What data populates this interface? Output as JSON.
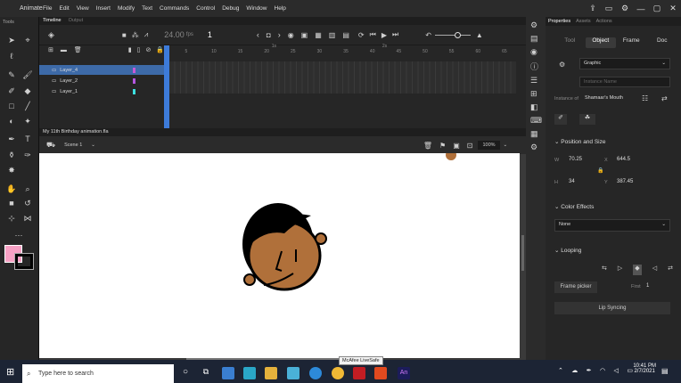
{
  "app": {
    "name": "Animate"
  },
  "menu": [
    "File",
    "Edit",
    "View",
    "Insert",
    "Modify",
    "Text",
    "Commands",
    "Control",
    "Debug",
    "Window",
    "Help"
  ],
  "tools_label": "Tools",
  "timeline": {
    "tabs": [
      "Timeline",
      "Output"
    ],
    "fps": "24.00",
    "fps_unit": "fps",
    "frame": "1",
    "layers": [
      {
        "name": "Layer_4",
        "color": "#c85ad6"
      },
      {
        "name": "Layer_2",
        "color": "#b557e0"
      },
      {
        "name": "Layer_1",
        "color": "#3de0e0"
      }
    ],
    "ruler": [
      "1s",
      "2s",
      "5",
      "10",
      "15",
      "20",
      "25",
      "30",
      "35",
      "40",
      "45",
      "50",
      "55",
      "60",
      "65"
    ]
  },
  "doc": {
    "tab": "My 11th Birthday animation.fla",
    "scene": "Scene 1",
    "zoom": "100%"
  },
  "props": {
    "tabs": [
      "Properties",
      "Assets",
      "Actions"
    ],
    "subtabs": [
      "Tool",
      "Object",
      "Frame",
      "Doc"
    ],
    "symbol_type": "Graphic",
    "instance_placeholder": "Instance Name",
    "instance_of_label": "Instance of",
    "instance_of": "Shamaar's Mouth",
    "pos_header": "Position and Size",
    "w_label": "W",
    "w": "70.25",
    "x_label": "X",
    "x": "644.5",
    "h_label": "H",
    "h": "34",
    "y_label": "Y",
    "y": "387.45",
    "color_header": "Color Effects",
    "color_effect": "None",
    "looping_header": "Looping",
    "frame_picker": "Frame picker",
    "first_label": "First",
    "first": "1",
    "lip": "Lip Syncing"
  },
  "taskbar": {
    "search_placeholder": "Type here to search",
    "tooltip": "McAfee LiveSafe",
    "time": "10:41 PM",
    "date": "2/7/2021"
  },
  "colors": {
    "fill": "#f7a1c4",
    "stroke": "#000000",
    "skin": "#b0703a",
    "accent": "#3d7bd9"
  }
}
